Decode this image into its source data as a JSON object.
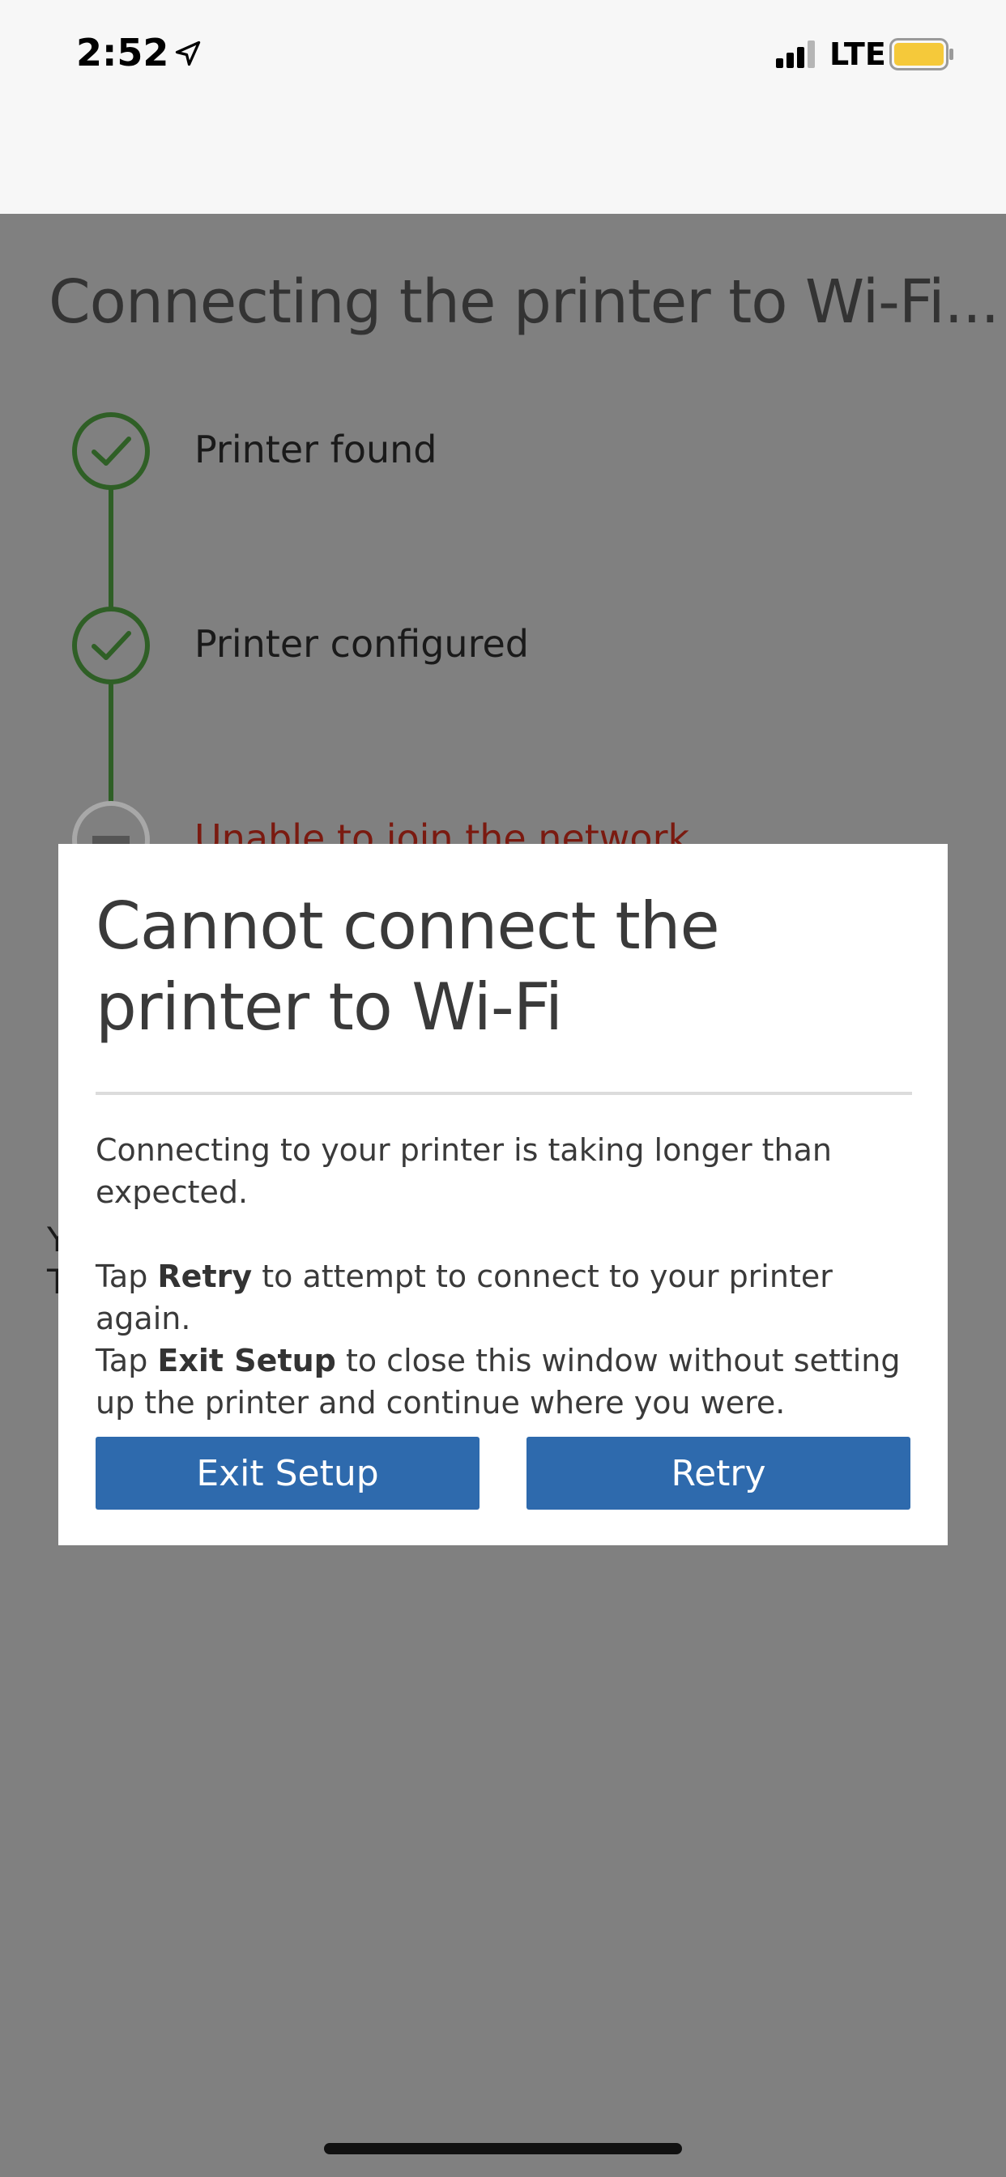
{
  "status_bar": {
    "time": "2:52",
    "network": "LTE",
    "icons": [
      "location-arrow-icon",
      "cellular-signal-icon",
      "battery-icon"
    ],
    "battery_color": "#f5c93a"
  },
  "page": {
    "title": "Connecting the printer to Wi-Fi...",
    "steps": [
      {
        "label": "Printer found",
        "status": "complete",
        "icon": "check-icon"
      },
      {
        "label": "Printer configured",
        "status": "complete",
        "icon": "check-icon"
      },
      {
        "label": "Unable to join the network",
        "status": "error",
        "icon": "minus-icon"
      }
    ],
    "obscured_text_fragments": [
      "Y",
      "T"
    ],
    "colors": {
      "complete": "#2f5f26",
      "error": "#7a1a10"
    }
  },
  "dialog": {
    "title": "Cannot connect the printer to Wi-Fi",
    "message": "Connecting to your printer is taking longer than expected.",
    "instructions": {
      "line1_prefix": "Tap ",
      "line1_bold": "Retry",
      "line1_suffix": " to attempt to connect to your printer again.",
      "line2_prefix": "Tap ",
      "line2_bold": "Exit Setup",
      "line2_suffix": " to close this window without setting up the printer and continue where you were."
    },
    "buttons": {
      "exit_label": "Exit Setup",
      "retry_label": "Retry"
    },
    "accent_color": "#2e6aad"
  }
}
